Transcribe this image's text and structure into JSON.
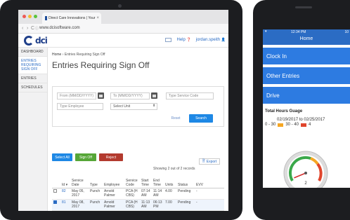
{
  "browser": {
    "tab_title": "Direct Care Innovations | Your",
    "tab_close": "×",
    "url": "www.dcisoftware.com",
    "back": "‹",
    "forward": "›",
    "reload": "C",
    "info": "ⓘ"
  },
  "app": {
    "logo_text": "dci",
    "help_label": "Help",
    "help_icon": "❓",
    "user_name": "jordan.speith",
    "user_icon": "👤",
    "mail_icon": "envelope-icon"
  },
  "sidebar": {
    "items": [
      {
        "label": "DASHBOARD"
      },
      {
        "label": "ENTRIES REQUIRING SIGN OFF"
      },
      {
        "label": "ENTRIES"
      },
      {
        "label": "SCHEDULES"
      }
    ]
  },
  "breadcrumb": {
    "home": "Home",
    "sep": "›",
    "current": "Entries Requiring Sign Off"
  },
  "page_title": "Entries Requiring Sign Off",
  "filters": {
    "from_placeholder": "From (MM/DD/YYYY)",
    "to_placeholder": "To (MM/DD/YYYY)",
    "service_code_placeholder": "Type Service Code",
    "employee_placeholder": "Type Employee",
    "unit_select": "Select Unit",
    "select_caret": "⬍",
    "reset_label": "Reset",
    "search_label": "Search"
  },
  "actions": {
    "select_all": "Select All",
    "sign_off": "Sign Off",
    "reject": "Reject",
    "export": "Export",
    "export_icon": "🗎",
    "showing": "Showing 2 out of 2 records"
  },
  "table": {
    "sort_indicator": "▾",
    "columns": [
      "Id",
      "Service Date",
      "Type",
      "Employee",
      "Service Code",
      "Start Time",
      "End Time",
      "Units",
      "Status",
      "EVV"
    ],
    "rows": [
      {
        "checked": false,
        "id": "82",
        "date": "May 05, 2017",
        "type": "Punch",
        "employee": "Arnold Palmer",
        "code": "PCA (H CBS)",
        "start": "07:14 AM",
        "end": "11:14 AM",
        "units": "4.00",
        "status": "Pending",
        "evv": "-"
      },
      {
        "checked": true,
        "id": "81",
        "date": "May 08, 2017",
        "type": "Punch",
        "employee": "Arnold Palmer",
        "code": "PCA (H CBS)",
        "start": "11:13 AM",
        "end": "06:13 PM",
        "units": "7.00",
        "status": "Pending",
        "evv": "-"
      }
    ]
  },
  "phone": {
    "signal": "▾",
    "time": "12:34 PM",
    "battery": "10",
    "header": "Home",
    "buttons": [
      {
        "label": "Clock In"
      },
      {
        "label": "Other Entries"
      },
      {
        "label": "Drive"
      }
    ],
    "guage_title": "Total Hours Guage",
    "guage_range": "02/19/2017 to 02/25/2017",
    "legend": [
      {
        "label": "0 - 30",
        "color": "#2d7be1"
      },
      {
        "label": "30 - 40",
        "color": "#f5a623"
      },
      {
        "label": "4",
        "color": "#e0452c"
      }
    ],
    "gauge_value": "2",
    "gauge_value_fraction": 0.05
  },
  "colors": {
    "primary": "#1e88e5",
    "mobile_blue": "#2d7be1",
    "sign_off_green": "#56a637",
    "reject_red": "#b33a2e"
  }
}
